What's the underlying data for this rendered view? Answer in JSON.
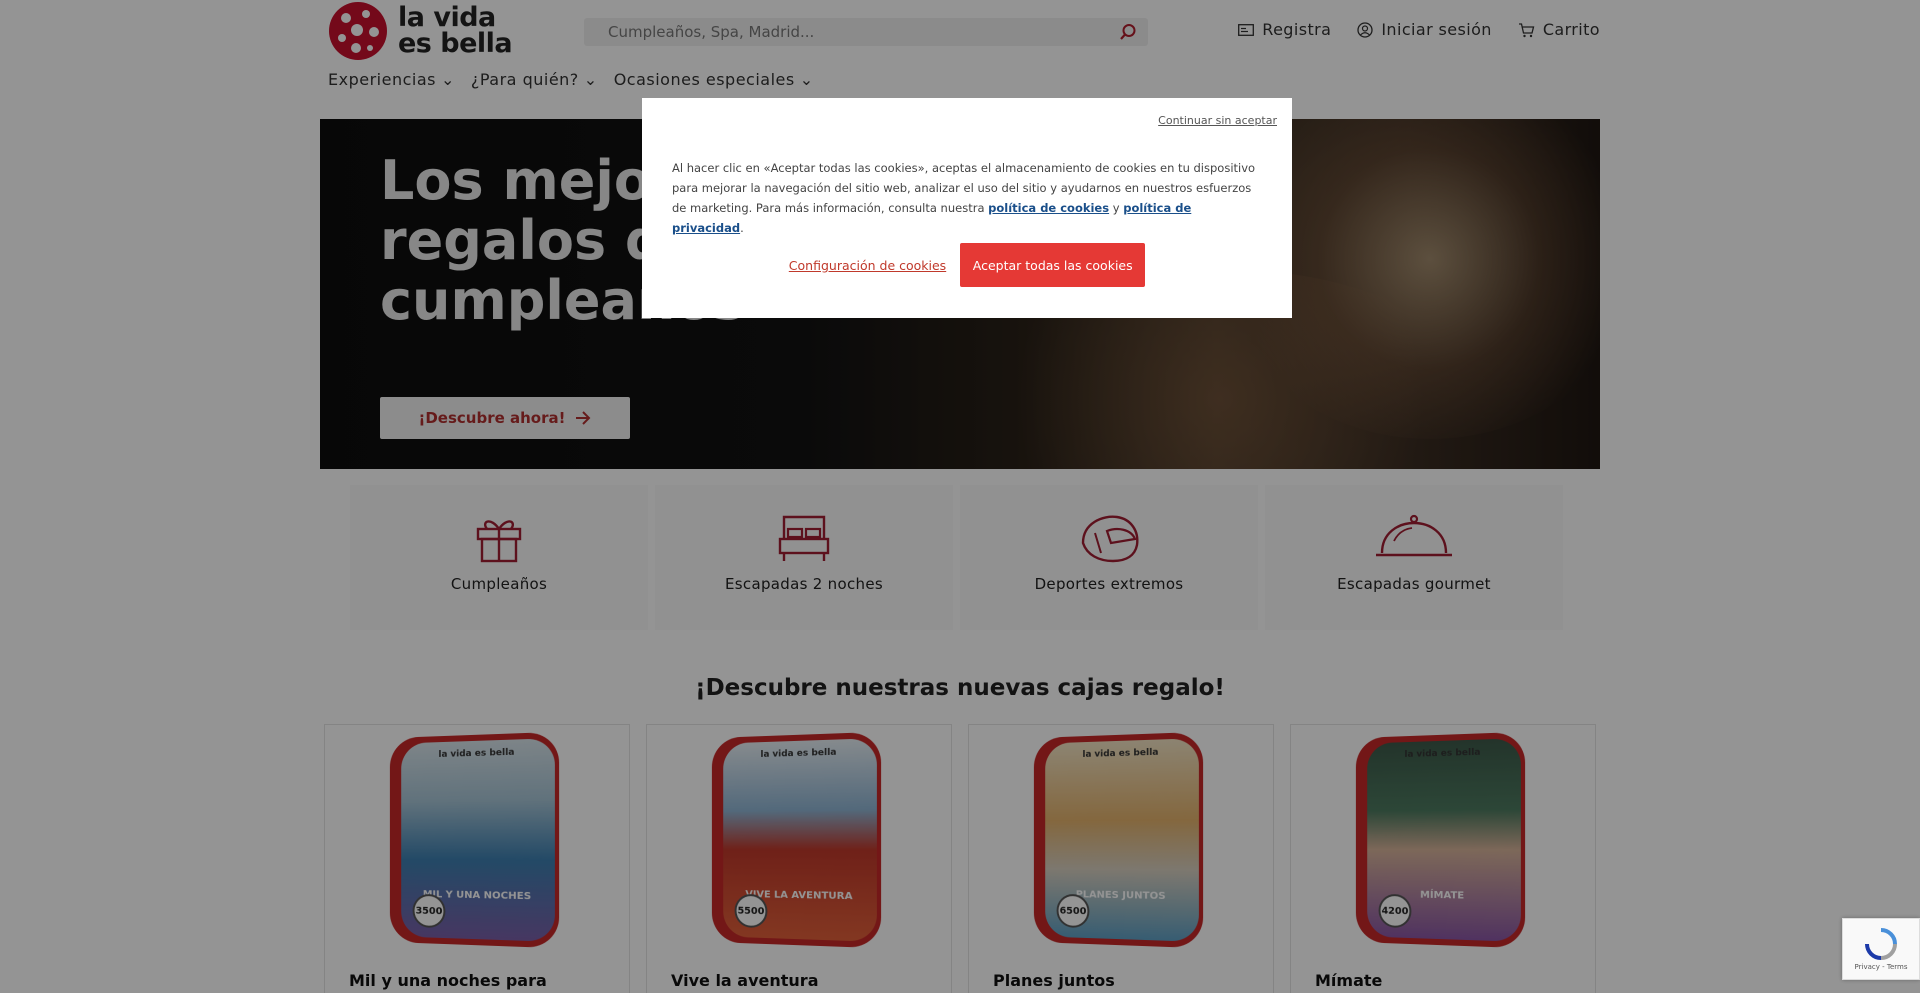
{
  "header": {
    "logo_text": "la vida\nes bella",
    "search_placeholder": "Cumpleaños, Spa, Madrid...",
    "register_label": "Registra",
    "login_label": "Iniciar sesión",
    "cart_label": "Carrito"
  },
  "nav": {
    "items": [
      {
        "label": "Experiencias"
      },
      {
        "label": "¿Para quién?"
      },
      {
        "label": "Ocasiones especiales"
      }
    ]
  },
  "hero": {
    "title_line1": "Los mejor",
    "title_line2": "regalos de",
    "title_line3": "cumpleaños",
    "cta_label": "¡Descubre ahora!"
  },
  "categories": [
    {
      "label": "Cumpleaños",
      "icon": "gift-icon"
    },
    {
      "label": "Escapadas 2 noches",
      "icon": "bed-icon"
    },
    {
      "label": "Deportes extremos",
      "icon": "helmet-icon"
    },
    {
      "label": "Escapadas gourmet",
      "icon": "cloche-icon"
    }
  ],
  "section_title": "¡Descubre nuestras nuevas cajas regalo!",
  "products": [
    {
      "title": "Mil y una noches para degustar",
      "box_name": "MIL Y UNA NOCHES",
      "badge": "3500",
      "colors": [
        "#3d7fb0",
        "#7a5fa8"
      ]
    },
    {
      "title": "Vive la aventura",
      "box_name": "VIVE LA AVENTURA",
      "badge": "5500",
      "colors": [
        "#4f87b5",
        "#e2603a"
      ]
    },
    {
      "title": "Planes juntos",
      "box_name": "PLANES JUNTOS",
      "badge": "6500",
      "colors": [
        "#e3b26c",
        "#5fa0c4"
      ]
    },
    {
      "title": "Mímate",
      "box_name": "MÍMATE",
      "badge": "4200",
      "colors": [
        "#4d7a60",
        "#8a57a5"
      ]
    }
  ],
  "cookie_modal": {
    "skip_label": "Continuar sin aceptar",
    "text": "Al hacer clic en «Aceptar todas las cookies», aceptas el almacenamiento de cookies en tu dispositivo para mejorar la navegación del sitio web, analizar el uso del sitio y ayudarnos en nuestros esfuerzos de marketing. Para más información, consulta nuestra",
    "cookies_policy_link": "política de cookies",
    "conjunction": "y",
    "privacy_policy_link": "política de privacidad",
    "period": ".",
    "config_label": "Configuración de cookies",
    "accept_label": "Aceptar todas las cookies"
  },
  "recaptcha": {
    "links": "Privacy - Terms"
  },
  "colors": {
    "brand_red": "#e53935",
    "link_blue": "#1a4f8a",
    "icon_red": "#a01e32"
  }
}
